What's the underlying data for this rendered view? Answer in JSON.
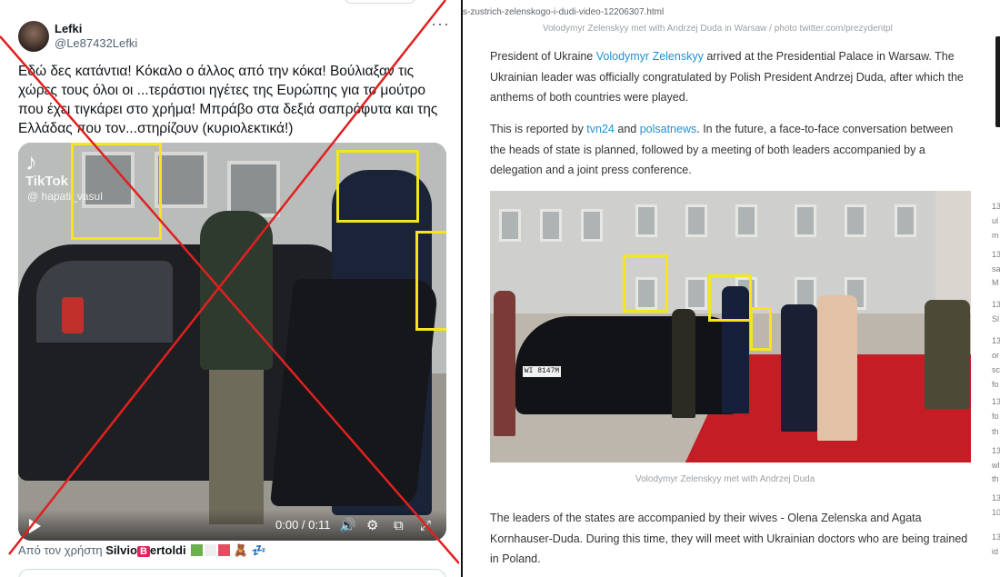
{
  "tweet": {
    "user_name": "Lefki",
    "user_handle": "@Le87432Lefki",
    "more_icon": "more-dots-icon",
    "text": "Εδώ δες κατάντια! Κόκαλο ο άλλος από την κόκα! Βούλιαξαν τις χώρες τους όλοι οι ...τεράστιοι ηγέτες της Ευρώπης για το μούτρο που έχει τιγκάρει στο χρήμα! Μπράβο στα δεξιά σαπρόφυτα και της Ελλάδας που τον...στηρίζουν (κυριολεκτικά!)",
    "video": {
      "watermark": "TikTok",
      "watermark_user": "@ hapati_vasul",
      "time": "0:00 / 0:11",
      "controls": [
        "play-icon",
        "volume-icon",
        "settings-icon",
        "pip-icon",
        "fullscreen-icon"
      ]
    },
    "footer_prefix": "Από τον χρήστη",
    "footer_user_a": "Silvio",
    "footer_badge": "B",
    "footer_user_b": "ertoldi",
    "footer_extra": "🧸 💤",
    "crossed_out_color": "#e02020",
    "highlight_color": "#f4e61a"
  },
  "article": {
    "url": "s-zustrich-zelenskogo-i-dudi-video-12206307.html",
    "top_caption": "Volodymyr Zelenskyy met with Andrzej Duda in Warsaw / photo twitter.com/prezydentpl",
    "p1_a": "President of Ukraine ",
    "p1_link": "Volodymyr Zelenskyy",
    "p1_b": " arrived at the Presidential Palace in Warsaw. The Ukrainian leader was officially congratulated by Polish President Andrzej Duda, after which the anthems of both countries were played.",
    "p2_a": "This is reported by ",
    "p2_link1": "tvn24",
    "p2_mid": " and ",
    "p2_link2": "polsatnews",
    "p2_b": ". In the future, a face-to-face conversation between the heads of state is planned, followed by a meeting of both leaders accompanied by a delegation and a joint press conference.",
    "plate": "WI 8147M",
    "photo_caption": "Volodymyr Zelenskyy met with Andrzej Duda",
    "p3": "The leaders of the states are accompanied by their wives - Olena Zelenska and Agata Kornhauser-Duda. During this time, they will meet with Ukrainian doctors who are being trained in Poland.",
    "link_color": "#1e90d6",
    "sidebar_fragments": [
      {
        "t": "13",
        "l": "ul"
      },
      {
        "t": "",
        "l": "m"
      },
      {
        "t": "13",
        "l": "sa"
      },
      {
        "t": "",
        "l": "M"
      },
      {
        "t": "13",
        "l": "Sl"
      },
      {
        "t": "13",
        "l": "or"
      },
      {
        "t": "",
        "l": "sc"
      },
      {
        "t": "",
        "l": "fo"
      },
      {
        "t": "13",
        "l": "fo"
      },
      {
        "t": "",
        "l": "th"
      },
      {
        "t": "13",
        "l": "wl"
      },
      {
        "t": "",
        "l": "th"
      },
      {
        "t": "13",
        "l": "10"
      },
      {
        "t": "13",
        "l": "id"
      }
    ]
  }
}
